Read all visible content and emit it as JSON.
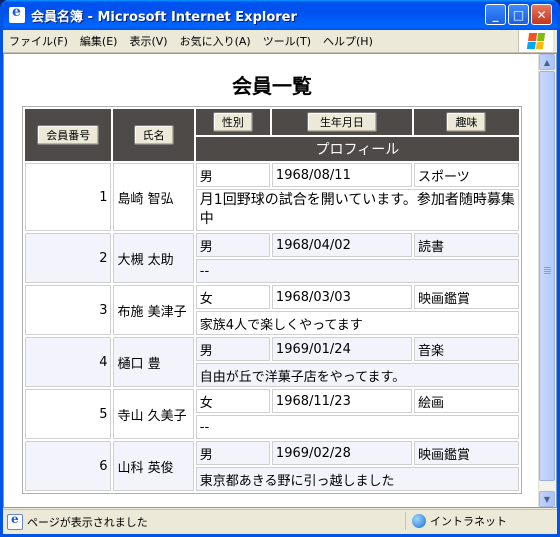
{
  "window": {
    "title": "会員名簿 - Microsoft Internet Explorer"
  },
  "menu": [
    "ファイル(F)",
    "編集(E)",
    "表示(V)",
    "お気に入り(A)",
    "ツール(T)",
    "ヘルプ(H)"
  ],
  "page": {
    "heading": "会員一覧",
    "headers": {
      "member_no": "会員番号",
      "name": "氏名",
      "gender": "性別",
      "birthday": "生年月日",
      "hobby": "趣味",
      "profile": "プロフィール"
    },
    "rows": [
      {
        "no": "1",
        "name": "島崎 智弘",
        "gender": "男",
        "birthday": "1968/08/11",
        "hobby": "スポーツ",
        "profile": "月1回野球の試合を開いています。参加者随時募集中"
      },
      {
        "no": "2",
        "name": "大槻 太助",
        "gender": "男",
        "birthday": "1968/04/02",
        "hobby": "読書",
        "profile": "--"
      },
      {
        "no": "3",
        "name": "布施 美津子",
        "gender": "女",
        "birthday": "1968/03/03",
        "hobby": "映画鑑賞",
        "profile": "家族4人で楽しくやってます"
      },
      {
        "no": "4",
        "name": "樋口 豊",
        "gender": "男",
        "birthday": "1969/01/24",
        "hobby": "音楽",
        "profile": "自由が丘で洋菓子店をやってます。"
      },
      {
        "no": "5",
        "name": "寺山 久美子",
        "gender": "女",
        "birthday": "1968/11/23",
        "hobby": "絵画",
        "profile": "--"
      },
      {
        "no": "6",
        "name": "山科 英俊",
        "gender": "男",
        "birthday": "1969/02/28",
        "hobby": "映画鑑賞",
        "profile": "東京都あきる野に引っ越しました"
      }
    ]
  },
  "status": {
    "text": "ページが表示されました",
    "zone": "イントラネット"
  }
}
